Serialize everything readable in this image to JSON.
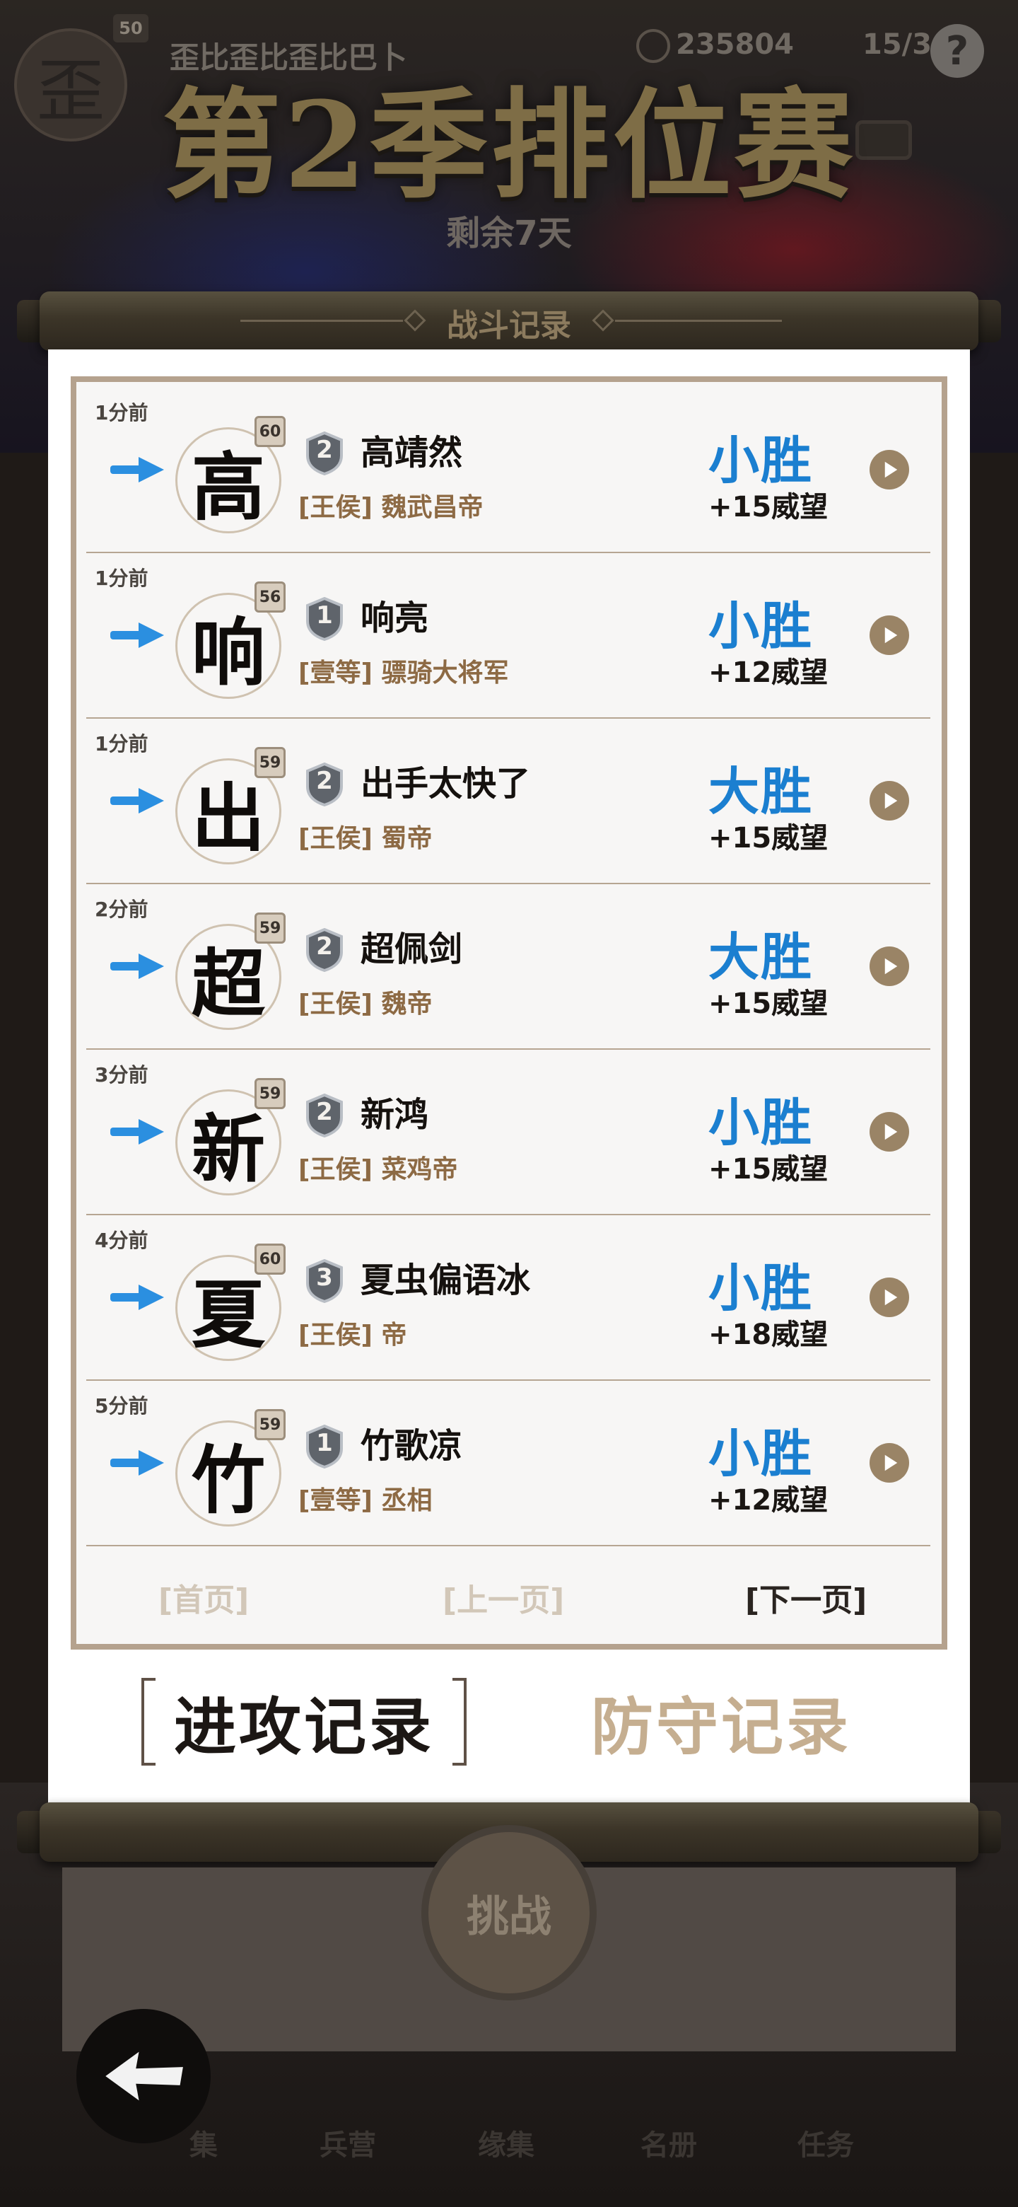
{
  "header": {
    "avatar_char": "歪",
    "level": "50",
    "player_name": "歪比歪比歪比巴卜",
    "coins": "235804",
    "stamina": "15/3",
    "help_label": "?"
  },
  "season": {
    "title": "第2季排位赛",
    "days_left": "剩余7天"
  },
  "scroll": {
    "title": "战斗记录"
  },
  "records": [
    {
      "time": "1分前",
      "char": "高",
      "level": "60",
      "rank": "2",
      "name": "高靖然",
      "title": "[王侯] 魏武昌帝",
      "result": "小胜",
      "points": "+15威望"
    },
    {
      "time": "1分前",
      "char": "响",
      "level": "56",
      "rank": "1",
      "name": "响亮",
      "title": "[壹等] 骠骑大将军",
      "result": "小胜",
      "points": "+12威望"
    },
    {
      "time": "1分前",
      "char": "出",
      "level": "59",
      "rank": "2",
      "name": "出手太快了",
      "title": "[王侯] 蜀帝",
      "result": "大胜",
      "points": "+15威望"
    },
    {
      "time": "2分前",
      "char": "超",
      "level": "59",
      "rank": "2",
      "name": "超佩剑",
      "title": "[王侯] 魏帝",
      "result": "大胜",
      "points": "+15威望"
    },
    {
      "time": "3分前",
      "char": "新",
      "level": "59",
      "rank": "2",
      "name": "新鸿",
      "title": "[王侯] 菜鸡帝",
      "result": "小胜",
      "points": "+15威望"
    },
    {
      "time": "4分前",
      "char": "夏",
      "level": "60",
      "rank": "3",
      "name": "夏虫偏语冰",
      "title": "[王侯] 帝",
      "result": "小胜",
      "points": "+18威望"
    },
    {
      "time": "5分前",
      "char": "竹",
      "level": "59",
      "rank": "1",
      "name": "竹歌凉",
      "title": "[壹等] 丞相",
      "result": "小胜",
      "points": "+12威望"
    }
  ],
  "pagination": {
    "first": "[首页]",
    "prev": "[上一页]",
    "next": "[下一页]"
  },
  "tabs": {
    "attack": "进攻记录",
    "defense": "防守记录"
  },
  "bottom": {
    "challenge": "挑战",
    "nav": [
      "集",
      "兵营",
      "缘集",
      "名册",
      "任务"
    ]
  },
  "colors": {
    "win_blue": "#1b7fd0",
    "title_brown": "#8d6a44",
    "frame_tan": "#b5a28e"
  },
  "icons": [
    "arrow-right-icon",
    "rank-badge-icon",
    "play-icon",
    "back-arrow-icon",
    "coin-icon",
    "mail-icon",
    "help-icon"
  ]
}
